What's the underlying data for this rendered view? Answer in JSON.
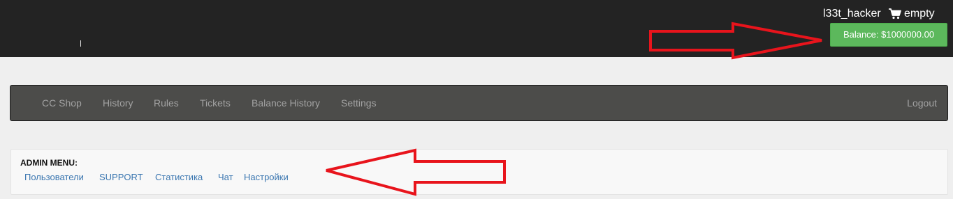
{
  "header": {
    "username": "l33t_hacker",
    "cart_label": "empty",
    "balance_label": "Balance: $1000000.00"
  },
  "nav": {
    "items": [
      {
        "label": "CC Shop"
      },
      {
        "label": "History"
      },
      {
        "label": "Rules"
      },
      {
        "label": "Tickets"
      },
      {
        "label": "Balance History"
      },
      {
        "label": "Settings"
      }
    ],
    "logout_label": "Logout"
  },
  "admin_menu": {
    "title": "ADMIN MENU:",
    "links": [
      {
        "label": "Пользователи"
      },
      {
        "label": "SUPPORT"
      },
      {
        "label": "Статистика"
      },
      {
        "label": "Чат"
      },
      {
        "label": "Настройки"
      }
    ]
  },
  "icons": {
    "cart": "shopping-cart-icon",
    "annotation": "red-arrow-annotation"
  },
  "colors": {
    "topbar_bg": "#232323",
    "balance_button": "#5cb85c",
    "navbar_bg": "#4c4c4a",
    "nav_text": "#a2a2a2",
    "admin_link": "#3a76b0",
    "annotation_red": "#e8141c"
  }
}
